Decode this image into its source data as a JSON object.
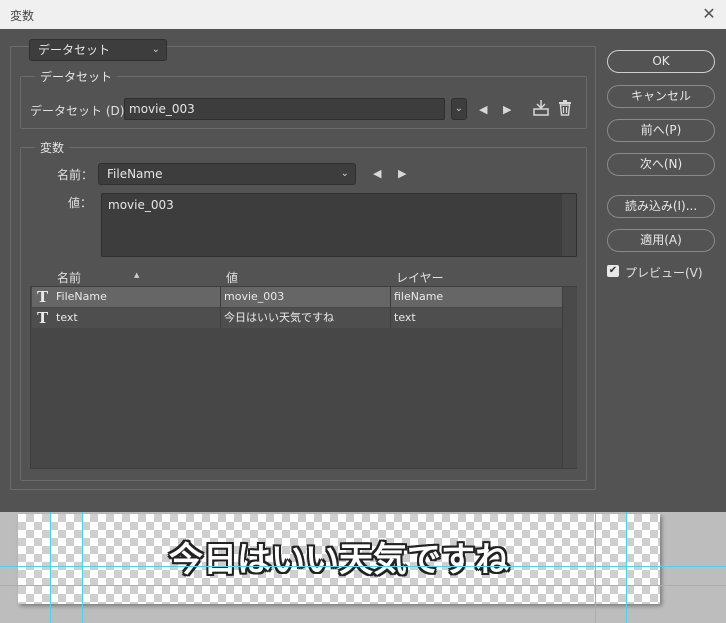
{
  "window": {
    "title": "変数",
    "close_glyph": "✕"
  },
  "top_dropdown": {
    "value": "データセット"
  },
  "dataset_group": {
    "title": "データセット",
    "label": "データセット (D)：",
    "value": "movie_003"
  },
  "variables_group": {
    "title": "変数",
    "name_label": "名前：",
    "name_value": "FileName",
    "value_label": "値：",
    "value_text": "movie_003"
  },
  "table": {
    "headers": [
      "名前",
      "値",
      "レイヤー"
    ],
    "sort_glyph": "▲",
    "rows": [
      {
        "icon": "T",
        "name": "FileName",
        "value": "movie_003",
        "layer": "fileName"
      },
      {
        "icon": "T",
        "name": "text",
        "value": "今日はいい天気ですね",
        "layer": "text"
      }
    ]
  },
  "buttons": {
    "ok": "OK",
    "cancel": "キャンセル",
    "prev": "前へ(P)",
    "next": "次へ(N)",
    "import": "読み込み(I)...",
    "apply": "適用(A)"
  },
  "preview": {
    "label": "プレビュー(V)",
    "checked": true,
    "check_glyph": "✔"
  },
  "canvas": {
    "text": "今日はいい天気ですね"
  },
  "glyphs": {
    "chevron": "⌄",
    "left": "◀",
    "right": "▶"
  },
  "colors": {
    "dialog_bg": "#535353",
    "field_bg": "#3d3d3d",
    "selected_row": "#666666",
    "guide": "#4dd2e8"
  }
}
